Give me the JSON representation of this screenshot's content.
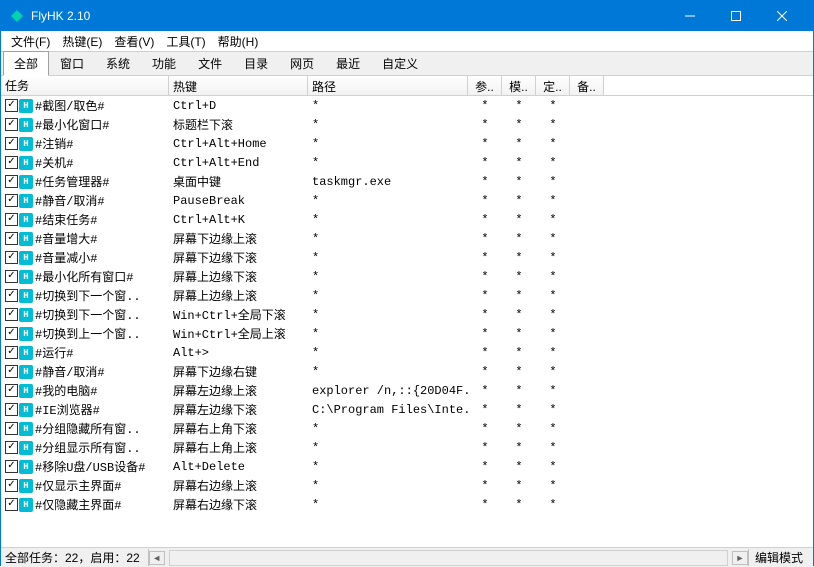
{
  "window": {
    "title": "FlyHK 2.10"
  },
  "menubar": [
    "文件(F)",
    "热键(E)",
    "查看(V)",
    "工具(T)",
    "帮助(H)"
  ],
  "toolbar": {
    "tabs": [
      "全部",
      "窗口",
      "系统",
      "功能",
      "文件",
      "目录",
      "网页",
      "最近",
      "自定义"
    ],
    "active": 0
  },
  "columns": {
    "task": "任务",
    "hotkey": "热键",
    "path": "路径",
    "param": "参..",
    "mode": "模..",
    "custom": "定..",
    "remark": "备.."
  },
  "rows": [
    {
      "task": "#截图/取色#",
      "hotkey": "Ctrl+D",
      "path": "*",
      "param": "*",
      "mode": "*",
      "custom": "*"
    },
    {
      "task": "#最小化窗口#",
      "hotkey": "标题栏下滚",
      "path": "*",
      "param": "*",
      "mode": "*",
      "custom": "*"
    },
    {
      "task": "#注销#",
      "hotkey": "Ctrl+Alt+Home",
      "path": "*",
      "param": "*",
      "mode": "*",
      "custom": "*"
    },
    {
      "task": "#关机#",
      "hotkey": "Ctrl+Alt+End",
      "path": "*",
      "param": "*",
      "mode": "*",
      "custom": "*"
    },
    {
      "task": "#任务管理器#",
      "hotkey": "桌面中键",
      "path": "taskmgr.exe",
      "param": "*",
      "mode": "*",
      "custom": "*"
    },
    {
      "task": "#静音/取消#",
      "hotkey": "PauseBreak",
      "path": "*",
      "param": "*",
      "mode": "*",
      "custom": "*"
    },
    {
      "task": "#结束任务#",
      "hotkey": "Ctrl+Alt+K",
      "path": "*",
      "param": "*",
      "mode": "*",
      "custom": "*"
    },
    {
      "task": "#音量增大#",
      "hotkey": "屏幕下边缘上滚",
      "path": "*",
      "param": "*",
      "mode": "*",
      "custom": "*"
    },
    {
      "task": "#音量减小#",
      "hotkey": "屏幕下边缘下滚",
      "path": "*",
      "param": "*",
      "mode": "*",
      "custom": "*"
    },
    {
      "task": "#最小化所有窗口#",
      "hotkey": "屏幕上边缘下滚",
      "path": "*",
      "param": "*",
      "mode": "*",
      "custom": "*"
    },
    {
      "task": "#切换到下一个窗..",
      "hotkey": "屏幕上边缘上滚",
      "path": "*",
      "param": "*",
      "mode": "*",
      "custom": "*"
    },
    {
      "task": "#切换到下一个窗..",
      "hotkey": "Win+Ctrl+全局下滚",
      "path": "*",
      "param": "*",
      "mode": "*",
      "custom": "*"
    },
    {
      "task": "#切换到上一个窗..",
      "hotkey": "Win+Ctrl+全局上滚",
      "path": "*",
      "param": "*",
      "mode": "*",
      "custom": "*"
    },
    {
      "task": "#运行#",
      "hotkey": "Alt+>",
      "path": "*",
      "param": "*",
      "mode": "*",
      "custom": "*"
    },
    {
      "task": "#静音/取消#",
      "hotkey": "屏幕下边缘右键",
      "path": "*",
      "param": "*",
      "mode": "*",
      "custom": "*"
    },
    {
      "task": "#我的电脑#",
      "hotkey": "屏幕左边缘上滚",
      "path": "explorer /n,::{20D04F..",
      "param": "*",
      "mode": "*",
      "custom": "*"
    },
    {
      "task": "#IE浏览器#",
      "hotkey": "屏幕左边缘下滚",
      "path": "C:\\Program Files\\Inte..",
      "param": "*",
      "mode": "*",
      "custom": "*"
    },
    {
      "task": "#分组隐藏所有窗..",
      "hotkey": "屏幕右上角下滚",
      "path": "*",
      "param": "*",
      "mode": "*",
      "custom": "*"
    },
    {
      "task": "#分组显示所有窗..",
      "hotkey": "屏幕右上角上滚",
      "path": "*",
      "param": "*",
      "mode": "*",
      "custom": "*"
    },
    {
      "task": "#移除U盘/USB设备#",
      "hotkey": "Alt+Delete",
      "path": "*",
      "param": "*",
      "mode": "*",
      "custom": "*"
    },
    {
      "task": "#仅显示主界面#",
      "hotkey": "屏幕右边缘上滚",
      "path": "*",
      "param": "*",
      "mode": "*",
      "custom": "*"
    },
    {
      "task": "#仅隐藏主界面#",
      "hotkey": "屏幕右边缘下滚",
      "path": "*",
      "param": "*",
      "mode": "*",
      "custom": "*"
    }
  ],
  "statusbar": {
    "status": "全部任务：22，启用：22",
    "mode": "编辑模式"
  }
}
